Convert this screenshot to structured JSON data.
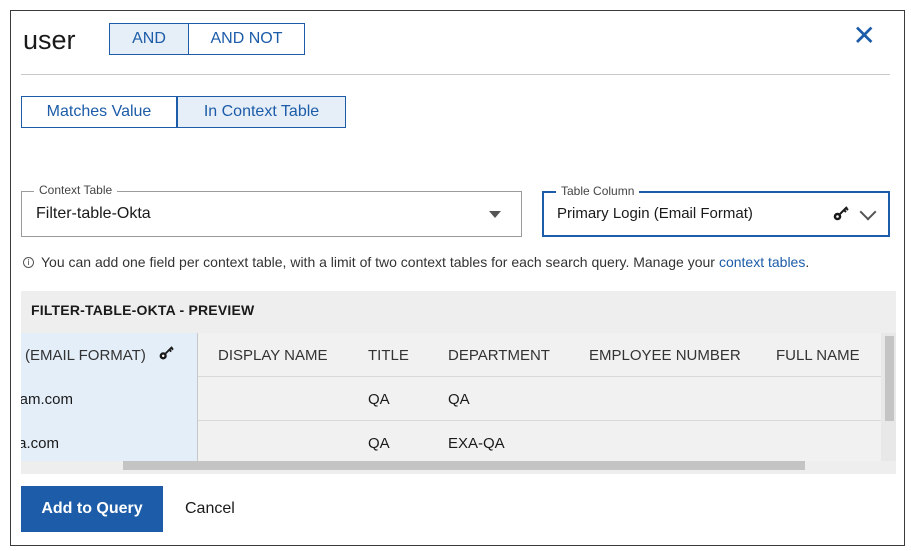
{
  "dialog": {
    "title": "user",
    "operators": [
      "AND",
      "AND NOT"
    ],
    "close_icon": "close-icon"
  },
  "match_tabs": [
    "Matches Value",
    "In Context Table"
  ],
  "context_table": {
    "label": "Context Table",
    "value": "Filter-table-Okta"
  },
  "table_column": {
    "label": "Table Column",
    "value": "Primary Login (Email Format)",
    "key_icon": "key-icon"
  },
  "info": {
    "text": "You can add one field per context table, with a limit of two context tables for each search query. Manage your",
    "link": "context tables",
    "suffix": "."
  },
  "preview": {
    "title": "FILTER-TABLE-OKTA - PREVIEW",
    "pinned_header": "(EMAIL FORMAT)",
    "headers": [
      "DISPLAY NAME",
      "TITLE",
      "DEPARTMENT",
      "EMPLOYEE NUMBER",
      "FULL NAME"
    ],
    "rows": [
      {
        "pinned": "am.com",
        "cells": [
          "",
          "QA",
          "QA",
          "",
          ""
        ]
      },
      {
        "pinned": "a.com",
        "cells": [
          "",
          "QA",
          "EXA-QA",
          "",
          ""
        ]
      }
    ]
  },
  "footer": {
    "add_label": "Add to Query",
    "cancel_label": "Cancel"
  },
  "colors": {
    "accent": "#1c5ca8",
    "pinned_column": "#e3eef9"
  }
}
